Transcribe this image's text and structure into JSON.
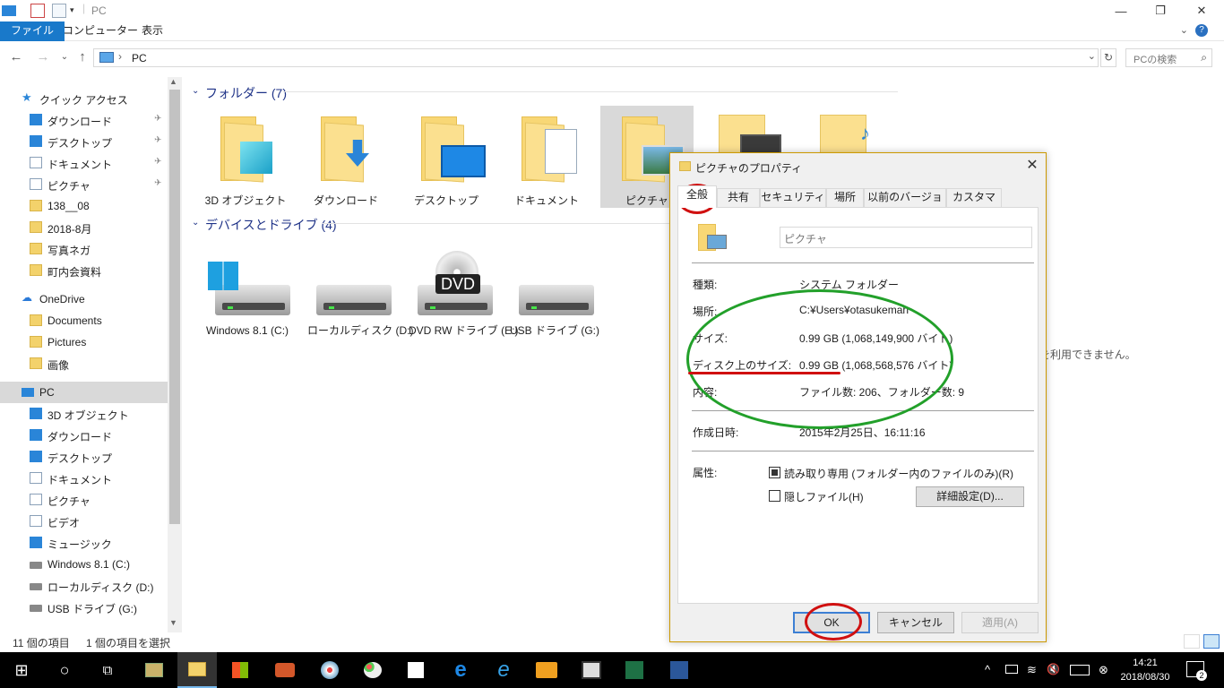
{
  "window": {
    "title": "PC",
    "minimize_glyph": "—",
    "restore_glyph": "❐",
    "close_glyph": "✕"
  },
  "ribbon": {
    "tabs": [
      "ファイル",
      "コンピューター",
      "表示"
    ],
    "help_glyph": "?",
    "collapse_glyph": "⌄"
  },
  "address": {
    "back_glyph": "←",
    "forward_glyph": "→",
    "recent_glyph": "⌄",
    "up_glyph": "↑",
    "separator": "›",
    "path": "PC",
    "dropdown_glyph": "⌄",
    "refresh_glyph": "↻",
    "search_placeholder": "PCの検索",
    "search_icon": "⌕"
  },
  "nav": {
    "quick_access": "クイック アクセス",
    "quick_items": [
      "ダウンロード",
      "デスクトップ",
      "ドキュメント",
      "ピクチャ",
      "138__08",
      "2018-8月",
      "写真ネガ",
      "町内会資料"
    ],
    "pin_glyph": "✈",
    "onedrive": "OneDrive",
    "onedrive_items": [
      "Documents",
      "Pictures",
      "画像"
    ],
    "pc": "PC",
    "pc_items": [
      "3D オブジェクト",
      "ダウンロード",
      "デスクトップ",
      "ドキュメント",
      "ピクチャ",
      "ビデオ",
      "ミュージック",
      "Windows 8.1 (C:)",
      "ローカルディスク (D:)",
      "USB ドライブ (G:)"
    ]
  },
  "content": {
    "folders_header": "フォルダー (7)",
    "folders": [
      "3D オブジェクト",
      "ダウンロード",
      "デスクトップ",
      "ドキュメント",
      "ピクチャ"
    ],
    "drives_header": "デバイスとドライブ (4)",
    "drives": [
      {
        "label": "Windows 8.1 (C:)"
      },
      {
        "label": "ローカルディスク (D:)"
      },
      {
        "label": "DVD RW ドライブ (E:)",
        "badge": "DVD"
      },
      {
        "label": "USB ドライブ (G:)"
      }
    ],
    "preview_message": "を利用できません。"
  },
  "status": {
    "items": "11 個の項目",
    "selected": "1 個の項目を選択"
  },
  "dialog": {
    "title": "ピクチャのプロパティ",
    "close_glyph": "✕",
    "tabs": [
      "全般",
      "共有",
      "セキュリティ",
      "場所",
      "以前のバージョン",
      "カスタマイズ"
    ],
    "name": "ピクチャ",
    "rows": [
      {
        "key": "種類:",
        "value": "システム フォルダー"
      },
      {
        "key": "場所:",
        "value": "C:¥Users¥otasukeman"
      },
      {
        "key": "サイズ:",
        "value": "0.99 GB (1,068,149,900 バイト)"
      },
      {
        "key": "ディスク上のサイズ:",
        "value": "0.99 GB (1,068,568,576 バイト)"
      },
      {
        "key": "内容:",
        "value": "ファイル数: 206、フォルダー数: 9"
      }
    ],
    "created_key": "作成日時:",
    "created_value": "2015年2月25日、16:11:16",
    "attributes_key": "属性:",
    "readonly_label": "読み取り専用 (フォルダー内のファイルのみ)(R)",
    "readonly_checked": true,
    "hidden_label": "隠しファイル(H)",
    "hidden_checked": false,
    "advanced_button": "詳細設定(D)...",
    "ok": "OK",
    "cancel": "キャンセル",
    "apply": "適用(A)"
  },
  "taskbar": {
    "start_glyph": "⊞",
    "search_glyph": "○",
    "taskview_glyph": "⧉",
    "tray_up": "^",
    "tray_volume": "🔇",
    "time": "14:21",
    "date": "2018/08/30",
    "notification_count": "2"
  },
  "colors": {
    "accent": "#1979ca",
    "annotation_red": "#d01010",
    "annotation_green": "#22a02a"
  }
}
